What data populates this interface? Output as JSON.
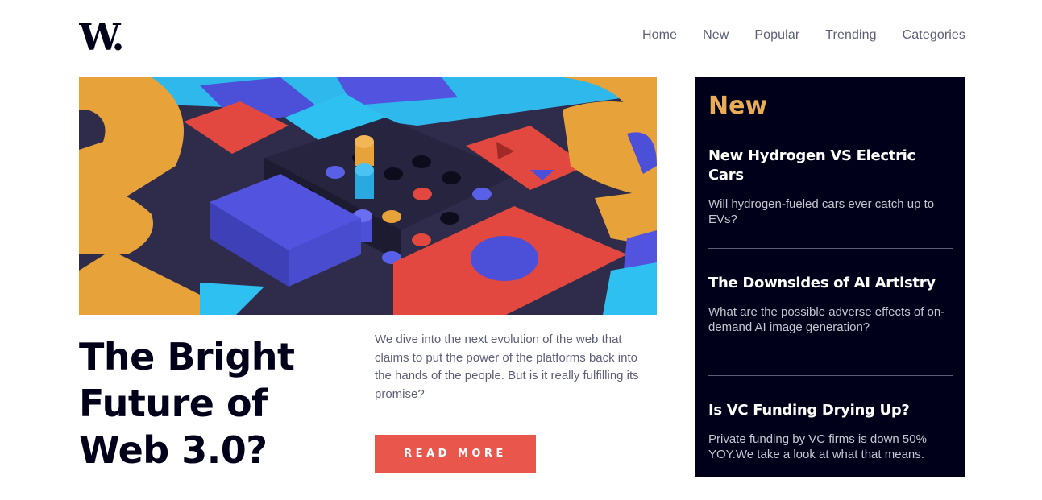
{
  "brand": {
    "logo_text": "W."
  },
  "nav": {
    "items": [
      {
        "label": "Home"
      },
      {
        "label": "New"
      },
      {
        "label": "Popular"
      },
      {
        "label": "Trending"
      },
      {
        "label": "Categories"
      }
    ]
  },
  "article": {
    "headline": "The Bright Future of Web 3.0?",
    "description": "We dive into the next evolution of the web that claims to put the power of the platforms back into the hands of the people. But is it really fulfilling its promise?",
    "cta_label": "READ MORE"
  },
  "sidebar": {
    "title": "New",
    "items": [
      {
        "title": "New Hydrogen VS Electric Cars",
        "summary": "Will hydrogen-fueled cars ever catch up to EVs?"
      },
      {
        "title": "The Downsides of AI Artistry",
        "summary": "What are the possible adverse effects of on-demand AI image generation?"
      },
      {
        "title": "Is VC Funding Drying Up?",
        "summary": "Private funding by VC firms is down 50% YOY.We take a look at what that means."
      }
    ]
  },
  "colors": {
    "accent_red": "#e9564b",
    "accent_orange": "#e9ab53",
    "dark_blue": "#00001a",
    "grayish_blue": "#5d5f79"
  }
}
